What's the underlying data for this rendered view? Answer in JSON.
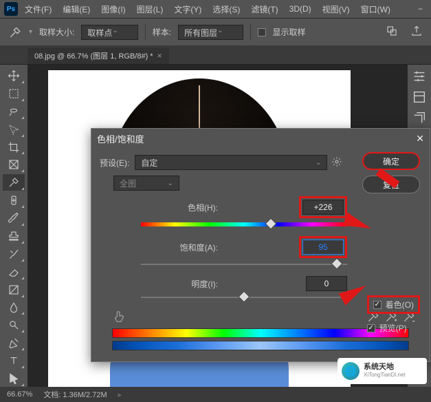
{
  "menu": {
    "items": [
      "文件(F)",
      "编辑(E)",
      "图像(I)",
      "图层(L)",
      "文字(Y)",
      "选择(S)",
      "滤镜(T)",
      "3D(D)",
      "视图(V)",
      "窗口(W)"
    ],
    "collapse": "−"
  },
  "options": {
    "sample_label": "取样大小:",
    "sample_value": "取样点",
    "sample2_label": "样本:",
    "sample2_value": "所有图层",
    "show_label": "显示取样"
  },
  "tab": {
    "title": "08.jpg @ 66.7% (图层 1, RGB/8#) *"
  },
  "dialog": {
    "title": "色相/饱和度",
    "preset_label": "预设(E):",
    "preset_value": "自定",
    "channel": "全图",
    "hue_label": "色相(H):",
    "hue_value": "+226",
    "sat_label": "饱和度(A):",
    "sat_value": "95",
    "light_label": "明度(I):",
    "light_value": "0",
    "ok": "确定",
    "reset": "复位",
    "colorize": "着色(O)",
    "preview": "预览(P)"
  },
  "status": {
    "zoom": "66.67%",
    "doc": "文档: 1.36M/2.72M"
  },
  "watermark": {
    "title": "系统天地",
    "sub": "XiTongTianDi.net"
  }
}
